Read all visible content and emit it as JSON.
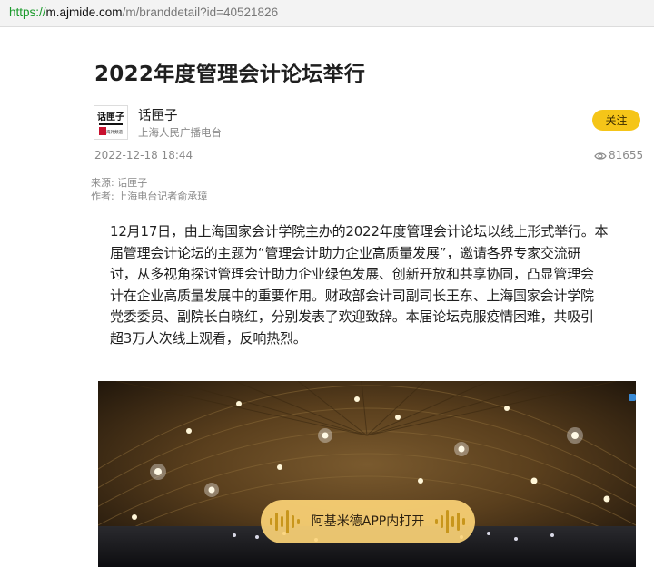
{
  "browser": {
    "url_scheme": "https://",
    "url_host": "m.ajmide.com",
    "url_path": "/m/branddetail?id=40521826"
  },
  "article": {
    "title": "2022年度管理会计论坛举行",
    "author": {
      "name": "话匣子",
      "subtitle": "上海人民广播电台",
      "avatar_text": "话匣子",
      "avatar_small": "海外频道"
    },
    "follow_label": "关注",
    "datetime": "2022-12-18 18:44",
    "views": "81655",
    "source": "来源: 话匣子",
    "reporter": "作者: 上海电台记者俞承璋",
    "body_lines": [
      "12月17日，由上海国家会计学院主办的2022年度管理会计论坛以线上形式举行。本",
      "届管理会计论坛的主题为“管理会计助力企业高质量发展”，邀请各界专家交流研",
      "讨，从多视角探讨管理会计助力企业绿色发展、创新开放和共享协同，凸显管理会",
      "计在企业高质量发展中的重要作用。财政部会计司副司长王东、上海国家会计学院",
      "党委委员、副院长白晓红，分别发表了欢迎致辞。本届论坛克服疫情困难，共吸引",
      "超3万人次线上观看，反响热烈。"
    ]
  },
  "media": {
    "open_app_label": "阿基米德APP内打开",
    "icon": "audio-wave-icon"
  },
  "colors": {
    "follow_bg": "#f5c518",
    "url_scheme": "#1a9a2b",
    "open_app_bg": "#ffd678"
  }
}
